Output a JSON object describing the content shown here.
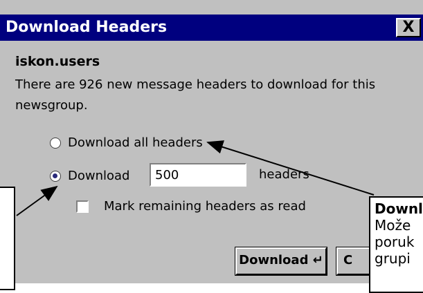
{
  "dialog": {
    "title": "Download Headers",
    "close_label": "X",
    "group_name": "iskon.users",
    "description": "There are 926 new message headers to download for this newsgroup.",
    "option_all_label": "Download all headers",
    "option_count_label": "Download",
    "count_value": "500",
    "count_suffix": "headers",
    "mark_read_label": "Mark remaining headers as read",
    "download_button": "Download",
    "cancel_button_partial": "C"
  },
  "callout": {
    "title": "Downl",
    "line1": "Može",
    "line2": "poruk",
    "line3": "grupi"
  },
  "state": {
    "selected_option": "download-count",
    "mark_read_checked": false
  },
  "colors": {
    "titlebar": "#00007f",
    "dialog_bg": "#c0c0c0"
  }
}
